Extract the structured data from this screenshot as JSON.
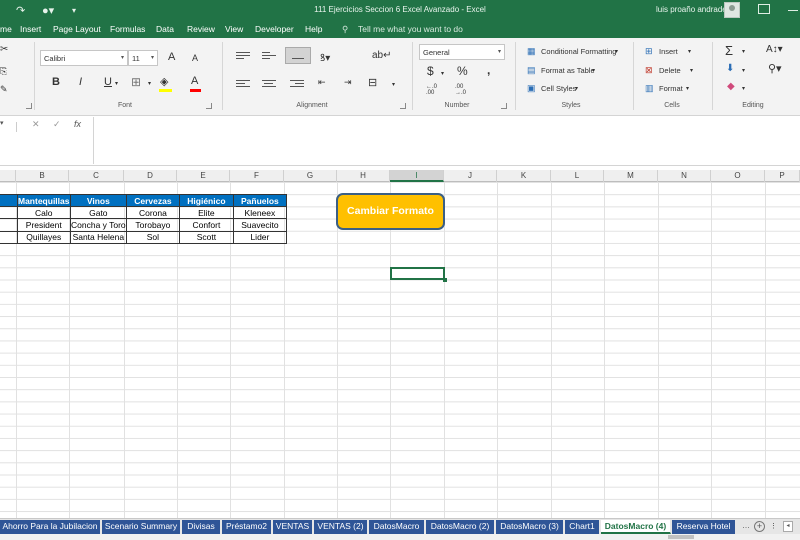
{
  "window": {
    "title": "111 Ejercicios Seccion 6 Excel Avanzado  -  Excel",
    "user": "luis proaño andrade"
  },
  "menu": {
    "tabs": [
      "me",
      "Insert",
      "Page Layout",
      "Formulas",
      "Data",
      "Review",
      "View",
      "Developer",
      "Help"
    ],
    "tell_me": "Tell me what you want to do"
  },
  "ribbon": {
    "font_name": "Calibri",
    "font_size": "11",
    "number_format": "General",
    "groups": {
      "font": "Font",
      "alignment": "Alignment",
      "number": "Number",
      "styles": "Styles",
      "cells": "Cells",
      "editing": "Editing"
    },
    "styles": {
      "conditional": "Conditional Formatting",
      "format_table": "Format as Table",
      "cell_styles": "Cell Styles"
    },
    "cells": {
      "insert": "Insert",
      "delete": "Delete",
      "format": "Format"
    },
    "font_buttons": {
      "bold": "B",
      "italic": "I",
      "underline": "U",
      "grow": "A",
      "shrink": "A",
      "color": "A"
    },
    "number_buttons": {
      "currency": "$",
      "percent": "%",
      "comma": ","
    }
  },
  "formula_bar": {
    "fx": "fx",
    "value": ""
  },
  "columns": [
    "B",
    "C",
    "D",
    "E",
    "F",
    "G",
    "H",
    "I",
    "J",
    "K",
    "L",
    "M",
    "N",
    "O",
    "P"
  ],
  "selected_column": "I",
  "table": {
    "headers": [
      "s",
      "Mantequillas",
      "Vinos",
      "Cervezas",
      "Higiénico",
      "Pañuelos"
    ],
    "rows": [
      [
        "e",
        "Calo",
        "Gato",
        "Corona",
        "Elite",
        "Kleneex"
      ],
      [
        "o",
        "President",
        "Concha y Toro",
        "Torobayo",
        "Confort",
        "Suavecito"
      ],
      [
        "t",
        "Quillayes",
        "Santa Helena",
        "Sol",
        "Scott",
        "Lider"
      ]
    ]
  },
  "macro_button": {
    "label": "Cambiar Formato"
  },
  "sheet_tabs": [
    "Ahorro Para la Jubilacion",
    "Scenario Summary",
    "Divisas",
    "Préstamo2",
    "VENTAS",
    "VENTAS (2)",
    "DatosMacro",
    "DatosMacro (2)",
    "DatosMacro (3)",
    "Chart1",
    "DatosMacro (4)",
    "Reserva Hotel"
  ],
  "active_sheet": "DatosMacro (4)",
  "colors": {
    "excel_green": "#217346",
    "table_header": "#0070c0",
    "macro_button_fill": "#ffc000",
    "macro_button_border": "#3b5f85",
    "sheet_tab_fill": "#2f5597"
  }
}
